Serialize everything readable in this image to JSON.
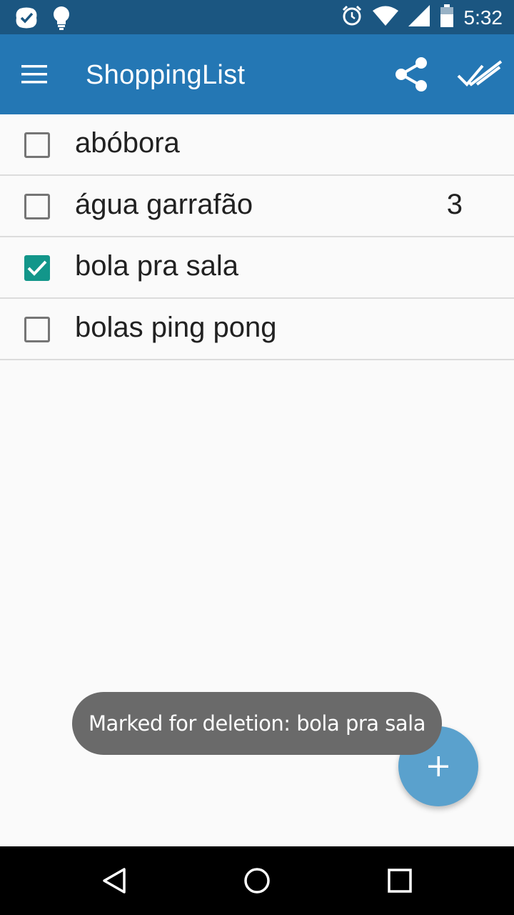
{
  "status_bar": {
    "time": "5:32",
    "icons": [
      "app-notification-icon",
      "lightbulb-icon",
      "alarm-icon",
      "wifi-icon",
      "cell-signal-icon",
      "battery-icon"
    ]
  },
  "app_bar": {
    "title": "ShoppingList",
    "icons": [
      "menu-icon",
      "share-icon",
      "check-all-icon"
    ],
    "color": "#2477b4"
  },
  "items": [
    {
      "label": "abóbora",
      "quantity": "",
      "checked": false
    },
    {
      "label": "água garrafão",
      "quantity": "3",
      "checked": false
    },
    {
      "label": "bola pra sala",
      "quantity": "",
      "checked": true
    },
    {
      "label": "bolas ping pong",
      "quantity": "",
      "checked": false
    }
  ],
  "toast": {
    "text": "Marked for deletion: bola pra sala"
  },
  "fab": {
    "icon": "plus-icon",
    "color": "#5aa1cd"
  },
  "nav_bar": {
    "icons": [
      "back-icon",
      "home-icon",
      "recents-icon"
    ]
  },
  "colors": {
    "status_bar": "#1b5681",
    "checkbox_checked": "#12968a"
  }
}
